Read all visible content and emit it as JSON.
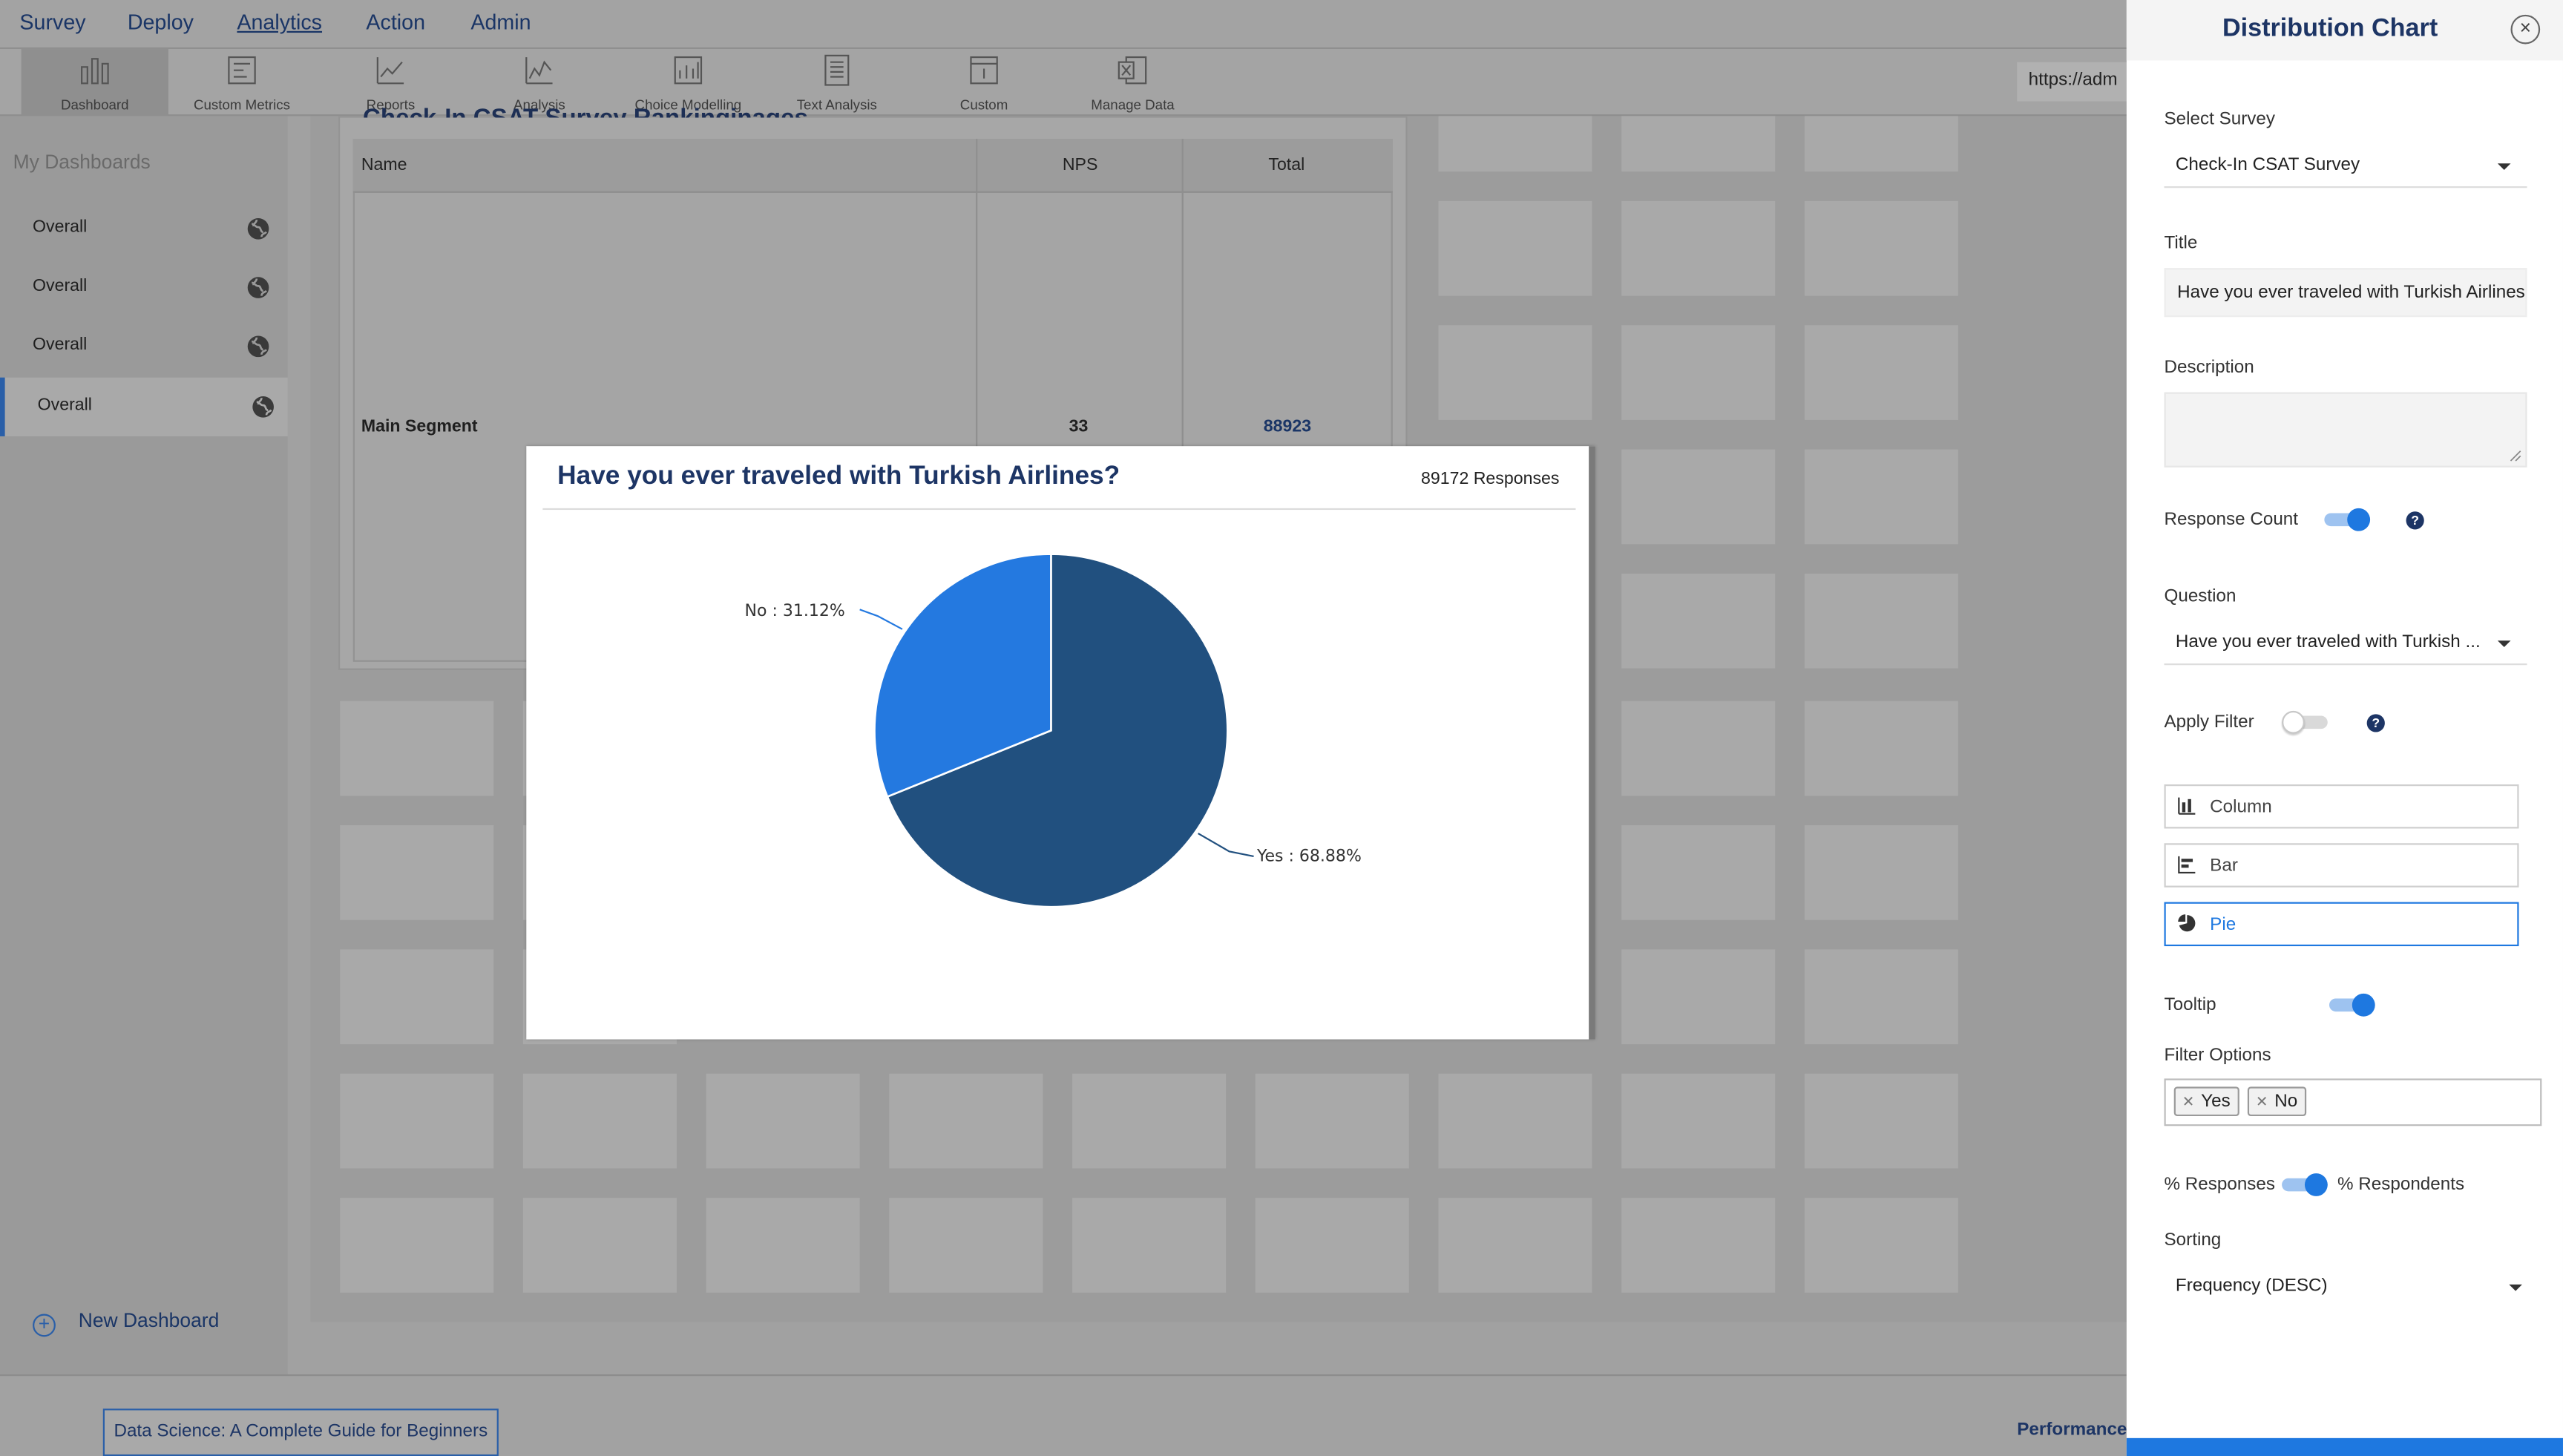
{
  "topnav": {
    "items": [
      "Survey",
      "Deploy",
      "Analytics",
      "Action",
      "Admin"
    ],
    "active": "Analytics"
  },
  "toolbar": {
    "items": [
      {
        "label": "Dashboard",
        "icon": "dashboard-bars-icon"
      },
      {
        "label": "Custom Metrics",
        "icon": "custom-metrics-icon"
      },
      {
        "label": "Reports",
        "icon": "reports-line-icon"
      },
      {
        "label": "Analysis",
        "icon": "analysis-line-icon"
      },
      {
        "label": "Choice Modelling",
        "icon": "choice-modelling-icon"
      },
      {
        "label": "Text Analysis",
        "icon": "text-analysis-icon"
      },
      {
        "label": "Custom",
        "icon": "custom-icon"
      },
      {
        "label": "Manage Data",
        "icon": "excel-icon"
      }
    ],
    "url_value": "https://adm"
  },
  "sidebar": {
    "title": "My Dashboards",
    "items": [
      {
        "label": "Overall"
      },
      {
        "label": "Overall"
      },
      {
        "label": "Overall"
      },
      {
        "label": "Overall"
      }
    ],
    "new_dashboard": "New Dashboard"
  },
  "table": {
    "title_cut": "Check-In CSAT Survey Rankinginages",
    "headers": [
      "Name",
      "NPS",
      "Total"
    ],
    "row": {
      "name": "Main Segment",
      "nps": "33",
      "total": "88923"
    }
  },
  "chart_modal": {
    "title": "Have you ever traveled with Turkish Airlines?",
    "responses": "89172 Responses"
  },
  "chart_data": {
    "type": "pie",
    "title": "Have you ever traveled with Turkish Airlines?",
    "slices": [
      {
        "label": "Yes",
        "value": 68.88,
        "display": "Yes : 68.88%",
        "color": "#21507f"
      },
      {
        "label": "No",
        "value": 31.12,
        "display": "No : 31.12%",
        "color": "#2479e0"
      }
    ]
  },
  "footer": {
    "course_button": "Data Science: A Complete Guide for Beginners",
    "right_text": "Performance"
  },
  "panel": {
    "title": "Distribution Chart",
    "select_survey_label": "Select Survey",
    "select_survey_value": "Check-In CSAT Survey",
    "title_label": "Title",
    "title_value": "Have you ever traveled with Turkish Airlines?",
    "description_label": "Description",
    "response_count_label": "Response Count",
    "question_label": "Question",
    "question_value": "Have you ever traveled with Turkish ...",
    "apply_filter_label": "Apply Filter",
    "chart_types": [
      {
        "label": "Column",
        "icon": "column-chart-icon"
      },
      {
        "label": "Bar",
        "icon": "bar-chart-icon"
      },
      {
        "label": "Pie",
        "icon": "pie-chart-icon"
      }
    ],
    "active_chart_type": "Pie",
    "tooltip_label": "Tooltip",
    "filter_options_label": "Filter Options",
    "filter_chips": [
      "Yes",
      "No"
    ],
    "pct_responses_label": "% Responses",
    "pct_respondents_label": "% Respondents",
    "sorting_label": "Sorting",
    "sorting_value": "Frequency (DESC)",
    "toggles": {
      "response_count": true,
      "apply_filter": false,
      "tooltip": true,
      "responses_vs_respondents": "respondents"
    },
    "accent_color": "#1e78e0",
    "heading_color": "#1d3565"
  }
}
